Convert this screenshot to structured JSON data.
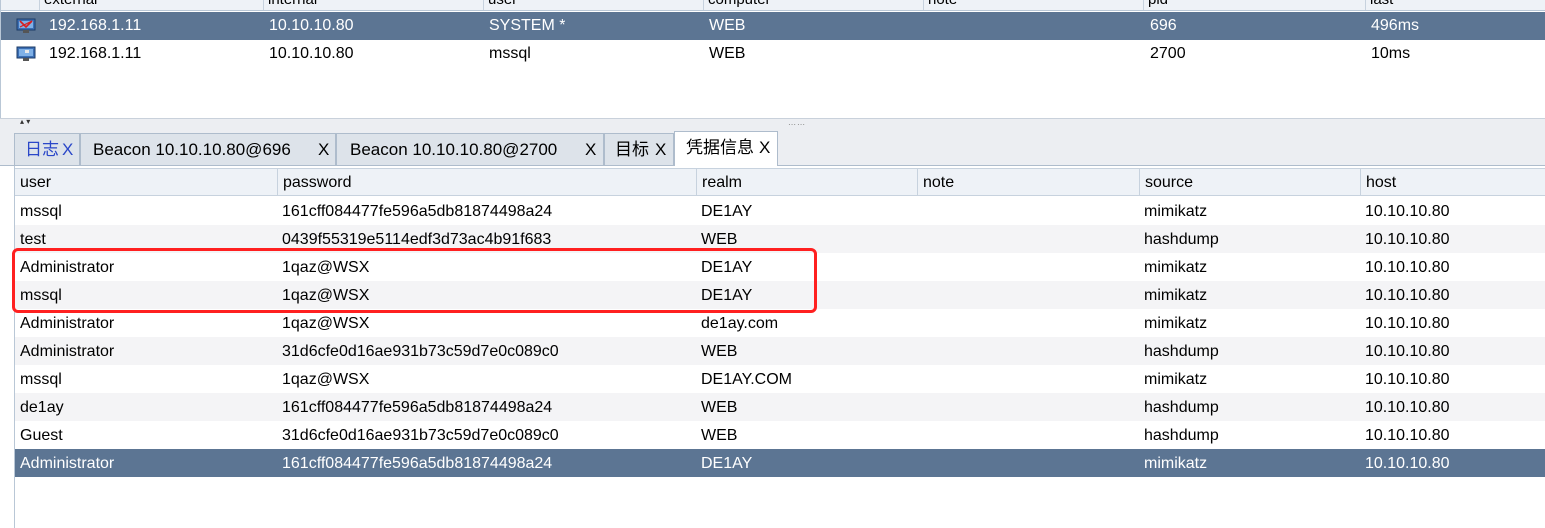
{
  "top_table": {
    "columns": [
      "external",
      "internal",
      "user",
      "computer",
      "note",
      "pid",
      "last"
    ],
    "rows": [
      {
        "external": "192.168.1.11",
        "internal": "10.10.10.80",
        "user": "SYSTEM *",
        "computer": "WEB",
        "note": "",
        "pid": "696",
        "last": "496ms",
        "selected": true,
        "icon": "beacon-admin-icon"
      },
      {
        "external": "192.168.1.11",
        "internal": "10.10.10.80",
        "user": "mssql",
        "computer": "WEB",
        "note": "",
        "pid": "2700",
        "last": "10ms",
        "selected": false,
        "icon": "beacon-icon"
      }
    ]
  },
  "tabs": [
    {
      "label": "日志",
      "close": "X"
    },
    {
      "label": "Beacon 10.10.10.80@696",
      "close": "X"
    },
    {
      "label": "Beacon 10.10.10.80@2700",
      "close": "X"
    },
    {
      "label": "目标",
      "close": "X"
    },
    {
      "label": "凭据信息",
      "close": "X"
    }
  ],
  "credentials": {
    "columns": [
      "user",
      "password",
      "realm",
      "note",
      "source",
      "host"
    ],
    "rows": [
      {
        "user": "mssql",
        "password": "161cff084477fe596a5db81874498a24",
        "realm": "DE1AY",
        "note": "",
        "source": "mimikatz",
        "host": "10.10.10.80"
      },
      {
        "user": "test",
        "password": "0439f55319e5114edf3d73ac4b91f683",
        "realm": "WEB",
        "note": "",
        "source": "hashdump",
        "host": "10.10.10.80"
      },
      {
        "user": "Administrator",
        "password": "1qaz@WSX",
        "realm": "DE1AY",
        "note": "",
        "source": "mimikatz",
        "host": "10.10.10.80"
      },
      {
        "user": "mssql",
        "password": "1qaz@WSX",
        "realm": "DE1AY",
        "note": "",
        "source": "mimikatz",
        "host": "10.10.10.80"
      },
      {
        "user": "Administrator",
        "password": "1qaz@WSX",
        "realm": "de1ay.com",
        "note": "",
        "source": "mimikatz",
        "host": "10.10.10.80"
      },
      {
        "user": "Administrator",
        "password": "31d6cfe0d16ae931b73c59d7e0c089c0",
        "realm": "WEB",
        "note": "",
        "source": "hashdump",
        "host": "10.10.10.80"
      },
      {
        "user": "mssql",
        "password": "1qaz@WSX",
        "realm": "DE1AY.COM",
        "note": "",
        "source": "mimikatz",
        "host": "10.10.10.80"
      },
      {
        "user": "de1ay",
        "password": "161cff084477fe596a5db81874498a24",
        "realm": "WEB",
        "note": "",
        "source": "hashdump",
        "host": "10.10.10.80"
      },
      {
        "user": "Guest",
        "password": "31d6cfe0d16ae931b73c59d7e0c089c0",
        "realm": "WEB",
        "note": "",
        "source": "hashdump",
        "host": "10.10.10.80"
      },
      {
        "user": "Administrator",
        "password": "161cff084477fe596a5db81874498a24",
        "realm": "DE1AY",
        "note": "",
        "source": "mimikatz",
        "host": "10.10.10.80"
      }
    ]
  },
  "colors": {
    "selection": "#5c7593",
    "highlight_box": "#ff2020",
    "chinese_tab_text": "#2a47c8"
  }
}
